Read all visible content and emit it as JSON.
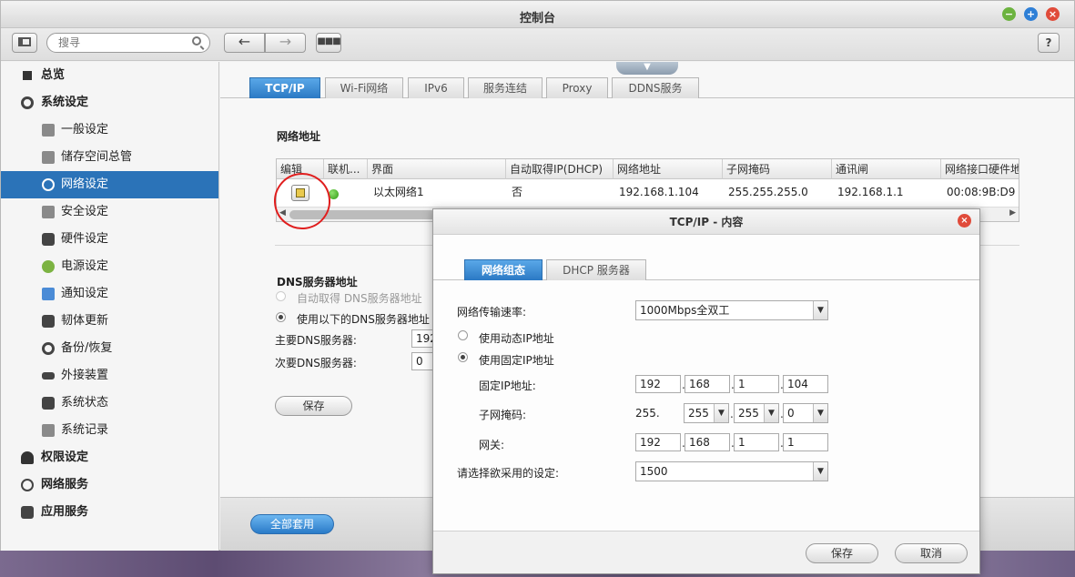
{
  "window": {
    "title": "控制台",
    "search_placeholder": "搜寻",
    "help": "?"
  },
  "sidebar": {
    "items": [
      {
        "label": "总览"
      },
      {
        "label": "系统设定"
      },
      {
        "label": "一般设定"
      },
      {
        "label": "储存空间总管"
      },
      {
        "label": "网络设定"
      },
      {
        "label": "安全设定"
      },
      {
        "label": "硬件设定"
      },
      {
        "label": "电源设定"
      },
      {
        "label": "通知设定"
      },
      {
        "label": "韧体更新"
      },
      {
        "label": "备份/恢复"
      },
      {
        "label": "外接装置"
      },
      {
        "label": "系统状态"
      },
      {
        "label": "系统记录"
      },
      {
        "label": "权限设定"
      },
      {
        "label": "网络服务"
      },
      {
        "label": "应用服务"
      }
    ]
  },
  "tabs": [
    "TCP/IP",
    "Wi-Fi网络",
    "IPv6",
    "服务连结",
    "Proxy",
    "DDNS服务"
  ],
  "network": {
    "section_title": "网络地址",
    "columns": [
      "编辑",
      "联机...",
      "界面",
      "自动取得IP(DHCP)",
      "网络地址",
      "子网掩码",
      "通讯闸",
      "网络接口硬件地"
    ],
    "row": {
      "interface": "以太网络1",
      "dhcp": "否",
      "ip": "192.168.1.104",
      "mask": "255.255.255.0",
      "gateway": "192.168.1.1",
      "mac": "00:08:9B:D9"
    }
  },
  "dns": {
    "section_title": "DNS服务器地址",
    "auto_label": "自动取得 DNS服务器地址",
    "manual_label": "使用以下的DNS服务器地址",
    "primary_label": "主要DNS服务器:",
    "primary_value": "192",
    "secondary_label": "次要DNS服务器:",
    "secondary_value": "0",
    "save": "保存"
  },
  "footer": {
    "apply_all": "全部套用"
  },
  "dialog": {
    "title": "TCP/IP - 内容",
    "tabs": [
      "网络组态",
      "DHCP 服务器"
    ],
    "speed_label": "网络传输速率:",
    "speed_value": "1000Mbps全双工",
    "dynamic_label": "使用动态IP地址",
    "static_label": "使用固定IP地址",
    "fixed_ip_label": "固定IP地址:",
    "fixed_ip": [
      "192",
      "168",
      "1",
      "104"
    ],
    "mask_label": "子网掩码:",
    "mask_first": "255.",
    "mask": [
      "255",
      "255",
      "0"
    ],
    "gateway_label": "网关:",
    "gateway": [
      "192",
      "168",
      "1",
      "1"
    ],
    "mtu_label": "请选择欲采用的设定:",
    "mtu_value": "1500",
    "save": "保存",
    "cancel": "取消"
  }
}
